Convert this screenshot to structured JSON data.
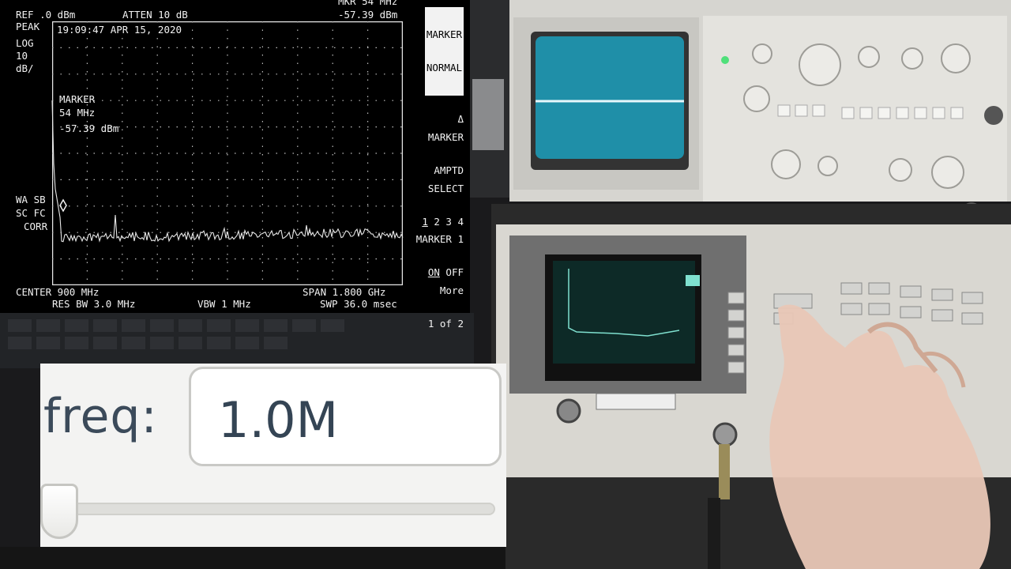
{
  "sa": {
    "ref": "REF .0 dBm",
    "atten": "ATTEN 10 dB",
    "mkr_top": "MKR 54 MHz",
    "mkr_top_level": "-57.39 dBm",
    "peak": "PEAK",
    "log": "LOG",
    "scale_value": "10",
    "scale_unit": "dB/",
    "timestamp": "19:09:47 APR 15, 2020",
    "marker_title": "MARKER",
    "marker_freq": "54 MHz",
    "marker_level": "-57.39 dBm",
    "wa_sb": "WA SB",
    "sc_fc": "SC FC",
    "corr": "CORR",
    "center": "CENTER 900 MHz",
    "span": "SPAN 1.800 GHz",
    "res_bw": "RES BW 3.0 MHz",
    "vbw": "VBW 1 MHz",
    "swp": "SWP 36.0 msec",
    "softkeys": {
      "k1a": "MARKER",
      "k1b": "NORMAL",
      "k2a": "MARKER",
      "k2b": "Δ",
      "k3a": "MARKER",
      "k3b": "AMPTD",
      "k4a": "SELECT",
      "k4b1": "1",
      "k4b2": " 2 3 4",
      "k5a": "MARKER 1",
      "k5b1": "ON",
      "k5b2": " OFF",
      "k6a": "More",
      "k6b": "1 of 2"
    }
  },
  "freq_widget": {
    "label": "freq:",
    "value": "1.0M",
    "slider_fraction": 0.0
  },
  "colors": {
    "scope_screen": "#1f8fa8",
    "trace": "#e8e8e8",
    "instrument_body": "#d9d7d1"
  }
}
